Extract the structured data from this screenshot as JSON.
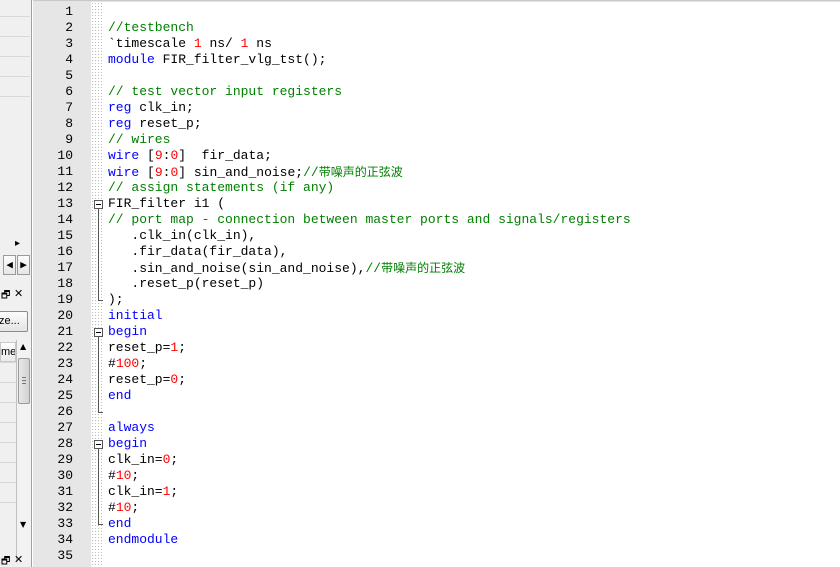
{
  "left_panel": {
    "button_label": "ze...",
    "column_header": "me",
    "scroll_right_icon": "triangle-right-icon",
    "scroll_left_icon": "triangle-left-icon",
    "restore_icon": "restore-window-icon",
    "close_icon": "close-icon"
  },
  "editor": {
    "lines": [
      {
        "n": "1",
        "tokens": []
      },
      {
        "n": "2",
        "tokens": [
          {
            "t": "//testbench",
            "c": "cm"
          }
        ]
      },
      {
        "n": "3",
        "tokens": [
          {
            "t": "`timescale ",
            "c": "pn"
          },
          {
            "t": "1",
            "c": "num"
          },
          {
            "t": " ns/ ",
            "c": "pn"
          },
          {
            "t": "1",
            "c": "num"
          },
          {
            "t": " ns",
            "c": "pn"
          }
        ]
      },
      {
        "n": "4",
        "tokens": [
          {
            "t": "module",
            "c": "kw"
          },
          {
            "t": " FIR_filter_vlg_tst();",
            "c": "pn"
          }
        ]
      },
      {
        "n": "5",
        "tokens": []
      },
      {
        "n": "6",
        "tokens": [
          {
            "t": "// test vector input registers",
            "c": "cm"
          }
        ]
      },
      {
        "n": "7",
        "tokens": [
          {
            "t": "reg",
            "c": "kw"
          },
          {
            "t": " clk_in;",
            "c": "pn"
          }
        ]
      },
      {
        "n": "8",
        "tokens": [
          {
            "t": "reg",
            "c": "kw"
          },
          {
            "t": " reset_p;",
            "c": "pn"
          }
        ]
      },
      {
        "n": "9",
        "tokens": [
          {
            "t": "// wires",
            "c": "cm"
          }
        ]
      },
      {
        "n": "10",
        "tokens": [
          {
            "t": "wire",
            "c": "kw"
          },
          {
            "t": " [",
            "c": "pn"
          },
          {
            "t": "9",
            "c": "num"
          },
          {
            "t": ":",
            "c": "pn"
          },
          {
            "t": "0",
            "c": "num"
          },
          {
            "t": "]  fir_data;",
            "c": "pn"
          }
        ]
      },
      {
        "n": "11",
        "tokens": [
          {
            "t": "wire",
            "c": "kw"
          },
          {
            "t": " [",
            "c": "pn"
          },
          {
            "t": "9",
            "c": "num"
          },
          {
            "t": ":",
            "c": "pn"
          },
          {
            "t": "0",
            "c": "num"
          },
          {
            "t": "] sin_and_noise;",
            "c": "pn"
          },
          {
            "t": "//",
            "c": "cm"
          },
          {
            "t": "带噪声的正弦波",
            "c": "cm cjk"
          }
        ]
      },
      {
        "n": "12",
        "tokens": [
          {
            "t": "// assign statements (if any)",
            "c": "cm"
          }
        ]
      },
      {
        "n": "13",
        "tokens": [
          {
            "t": "FIR_filter i1 (",
            "c": "pn"
          }
        ]
      },
      {
        "n": "14",
        "tokens": [
          {
            "t": "// port map - connection between master ports and signals/registers",
            "c": "cm"
          }
        ]
      },
      {
        "n": "15",
        "tokens": [
          {
            "t": "   .clk_in(clk_in),",
            "c": "pn"
          }
        ]
      },
      {
        "n": "16",
        "tokens": [
          {
            "t": "   .fir_data(fir_data),",
            "c": "pn"
          }
        ]
      },
      {
        "n": "17",
        "tokens": [
          {
            "t": "   .sin_and_noise(sin_and_noise),",
            "c": "pn"
          },
          {
            "t": "//",
            "c": "cm"
          },
          {
            "t": "带噪声的正弦波",
            "c": "cm cjk"
          }
        ]
      },
      {
        "n": "18",
        "tokens": [
          {
            "t": "   .reset_p(reset_p)",
            "c": "pn"
          }
        ]
      },
      {
        "n": "19",
        "tokens": [
          {
            "t": ");",
            "c": "pn"
          }
        ]
      },
      {
        "n": "20",
        "tokens": [
          {
            "t": "initial",
            "c": "kw"
          }
        ]
      },
      {
        "n": "21",
        "tokens": [
          {
            "t": "begin",
            "c": "kw"
          }
        ]
      },
      {
        "n": "22",
        "tokens": [
          {
            "t": "reset_p=",
            "c": "pn"
          },
          {
            "t": "1",
            "c": "num"
          },
          {
            "t": ";",
            "c": "pn"
          }
        ]
      },
      {
        "n": "23",
        "tokens": [
          {
            "t": "#",
            "c": "pn"
          },
          {
            "t": "100",
            "c": "num"
          },
          {
            "t": ";",
            "c": "pn"
          }
        ]
      },
      {
        "n": "24",
        "tokens": [
          {
            "t": "reset_p=",
            "c": "pn"
          },
          {
            "t": "0",
            "c": "num"
          },
          {
            "t": ";",
            "c": "pn"
          }
        ]
      },
      {
        "n": "25",
        "tokens": [
          {
            "t": "end",
            "c": "kw"
          }
        ]
      },
      {
        "n": "26",
        "tokens": []
      },
      {
        "n": "27",
        "tokens": [
          {
            "t": "always",
            "c": "kw"
          }
        ]
      },
      {
        "n": "28",
        "tokens": [
          {
            "t": "begin",
            "c": "kw"
          }
        ]
      },
      {
        "n": "29",
        "tokens": [
          {
            "t": "clk_in=",
            "c": "pn"
          },
          {
            "t": "0",
            "c": "num"
          },
          {
            "t": ";",
            "c": "pn"
          }
        ]
      },
      {
        "n": "30",
        "tokens": [
          {
            "t": "#",
            "c": "pn"
          },
          {
            "t": "10",
            "c": "num"
          },
          {
            "t": ";",
            "c": "pn"
          }
        ]
      },
      {
        "n": "31",
        "tokens": [
          {
            "t": "clk_in=",
            "c": "pn"
          },
          {
            "t": "1",
            "c": "num"
          },
          {
            "t": ";",
            "c": "pn"
          }
        ]
      },
      {
        "n": "32",
        "tokens": [
          {
            "t": "#",
            "c": "pn"
          },
          {
            "t": "10",
            "c": "num"
          },
          {
            "t": ";",
            "c": "pn"
          }
        ]
      },
      {
        "n": "33",
        "tokens": [
          {
            "t": "end",
            "c": "kw"
          }
        ]
      },
      {
        "n": "34",
        "tokens": [
          {
            "t": "endmodule",
            "c": "kw"
          }
        ]
      },
      {
        "n": "35",
        "tokens": []
      }
    ],
    "fold_regions": [
      {
        "start": "13",
        "end": "19"
      },
      {
        "start": "21",
        "end": "26"
      },
      {
        "start": "28",
        "end": "33"
      }
    ]
  },
  "colors": {
    "keyword": "#0000ff",
    "comment": "#008000",
    "number": "#ff0000",
    "gutter": "#e6e6e6"
  }
}
